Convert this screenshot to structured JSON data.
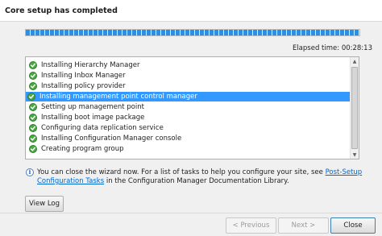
{
  "header": {
    "title": "Core setup has completed"
  },
  "progress": {
    "percent": 100
  },
  "elapsed": {
    "text": "Elapsed time: 00:28:13"
  },
  "tasks": [
    {
      "label": "Installing Hierarchy Manager",
      "status": "complete",
      "selected": false
    },
    {
      "label": "Installing Inbox Manager",
      "status": "complete",
      "selected": false
    },
    {
      "label": "Installing policy provider",
      "status": "complete",
      "selected": false
    },
    {
      "label": "Installing management point control manager",
      "status": "complete",
      "selected": true
    },
    {
      "label": "Setting up management point",
      "status": "complete",
      "selected": false
    },
    {
      "label": "Installing boot image package",
      "status": "complete",
      "selected": false
    },
    {
      "label": "Configuring data replication service",
      "status": "complete",
      "selected": false
    },
    {
      "label": "Installing Configuration Manager console",
      "status": "complete",
      "selected": false
    },
    {
      "label": "Creating program group",
      "status": "complete",
      "selected": false
    }
  ],
  "info": {
    "text_before": "You can close the wizard now. For a list of tasks to help you configure your site, see ",
    "link_text": "Post-Setup Configuration Tasks",
    "text_after": " in the Configuration Manager Documentation Library."
  },
  "buttons": {
    "view_log": "View Log",
    "previous": "< Previous",
    "next": "Next >",
    "close": "Close"
  },
  "colors": {
    "progress": "#2f8ee0",
    "selection": "#3399ff",
    "success": "#4aa843",
    "link": "#0066cc"
  }
}
